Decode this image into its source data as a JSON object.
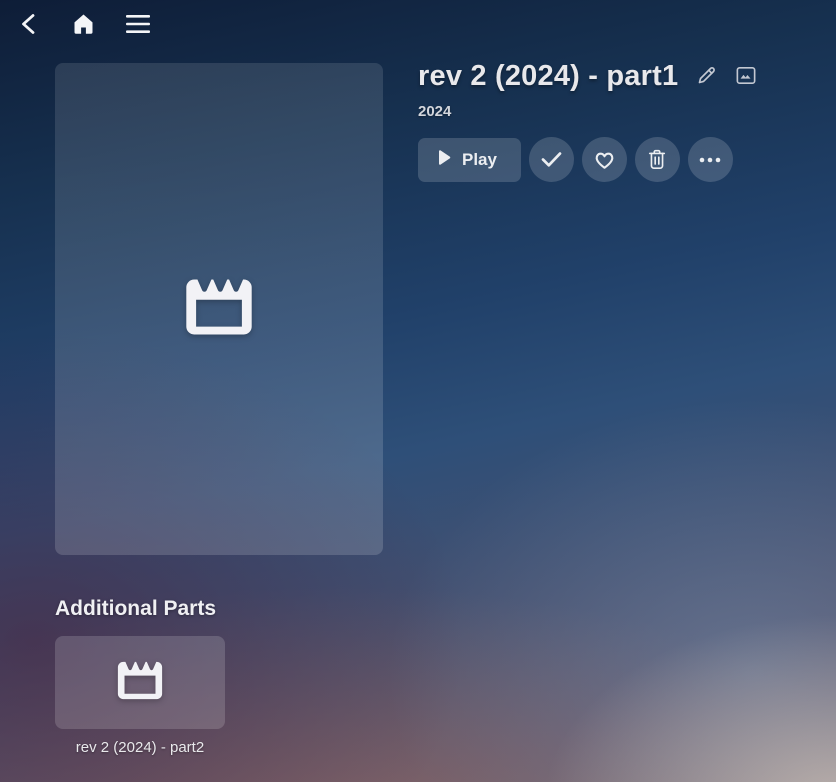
{
  "header": {
    "back_icon": "chevron-left-icon",
    "home_icon": "home-icon",
    "menu_icon": "hamburger-menu-icon"
  },
  "detail": {
    "title": "rev 2 (2024) - part1",
    "year": "2024",
    "poster_icon": "clapperboard-icon",
    "title_icons": [
      "pencil-edit-icon",
      "image-icon"
    ],
    "actions": {
      "play_label": "Play",
      "icons": [
        "play-icon",
        "check-icon",
        "heart-icon",
        "trash-icon",
        "ellipsis-icon"
      ]
    }
  },
  "additional_parts": {
    "heading": "Additional Parts",
    "items": [
      {
        "label": "rev 2 (2024) - part2",
        "icon": "clapperboard-icon"
      }
    ]
  },
  "colors": {
    "bg_top": "#0e1d37",
    "bg_mid_blue": "#2e4f78",
    "bg_bottom_mauve": "#685d6a",
    "button_bg": "rgba(255,255,255,0.165)",
    "text": "#e9e9ec"
  }
}
